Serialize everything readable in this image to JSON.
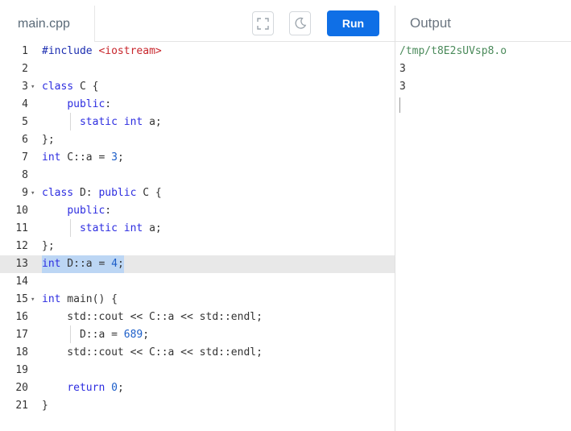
{
  "editor": {
    "file_tab": "main.cpp",
    "fullscreen_icon": "fullscreen-icon",
    "theme_icon": "moon-icon",
    "run_label": "Run",
    "active_line": 13,
    "lines": [
      {
        "n": "1",
        "fold": false,
        "tokens": [
          {
            "t": "#include ",
            "c": "kw"
          },
          {
            "t": "<iostream>",
            "c": "str"
          }
        ]
      },
      {
        "n": "2",
        "fold": false,
        "tokens": []
      },
      {
        "n": "3",
        "fold": true,
        "tokens": [
          {
            "t": "class",
            "c": "kw2"
          },
          {
            "t": " C {",
            "c": "pl"
          }
        ]
      },
      {
        "n": "4",
        "fold": false,
        "tokens": [
          {
            "t": "    ",
            "c": "pl"
          },
          {
            "t": "public",
            "c": "kw2"
          },
          {
            "t": ":",
            "c": "pl"
          }
        ]
      },
      {
        "n": "5",
        "fold": false,
        "tokens": [
          {
            "t": "      ",
            "c": "pl"
          },
          {
            "t": "static",
            "c": "kw2"
          },
          {
            "t": " ",
            "c": "pl"
          },
          {
            "t": "int",
            "c": "kw2"
          },
          {
            "t": " a;",
            "c": "pl"
          }
        ]
      },
      {
        "n": "6",
        "fold": false,
        "tokens": [
          {
            "t": "};",
            "c": "pl"
          }
        ]
      },
      {
        "n": "7",
        "fold": false,
        "tokens": [
          {
            "t": "int",
            "c": "kw2"
          },
          {
            "t": " C::a = ",
            "c": "pl"
          },
          {
            "t": "3",
            "c": "num"
          },
          {
            "t": ";",
            "c": "pl"
          }
        ]
      },
      {
        "n": "8",
        "fold": false,
        "tokens": []
      },
      {
        "n": "9",
        "fold": true,
        "tokens": [
          {
            "t": "class",
            "c": "kw2"
          },
          {
            "t": " D: ",
            "c": "pl"
          },
          {
            "t": "public",
            "c": "kw2"
          },
          {
            "t": " C {",
            "c": "pl"
          }
        ]
      },
      {
        "n": "10",
        "fold": false,
        "tokens": [
          {
            "t": "    ",
            "c": "pl"
          },
          {
            "t": "public",
            "c": "kw2"
          },
          {
            "t": ":",
            "c": "pl"
          }
        ]
      },
      {
        "n": "11",
        "fold": false,
        "tokens": [
          {
            "t": "      ",
            "c": "pl"
          },
          {
            "t": "static",
            "c": "kw2"
          },
          {
            "t": " ",
            "c": "pl"
          },
          {
            "t": "int",
            "c": "kw2"
          },
          {
            "t": " a;",
            "c": "pl"
          }
        ]
      },
      {
        "n": "12",
        "fold": false,
        "tokens": [
          {
            "t": "};",
            "c": "pl"
          }
        ]
      },
      {
        "n": "13",
        "fold": false,
        "selected": true,
        "tokens": [
          {
            "t": "int",
            "c": "kw2"
          },
          {
            "t": " D::a = ",
            "c": "pl"
          },
          {
            "t": "4",
            "c": "num"
          },
          {
            "t": ";",
            "c": "pl"
          }
        ]
      },
      {
        "n": "14",
        "fold": false,
        "tokens": []
      },
      {
        "n": "15",
        "fold": true,
        "tokens": [
          {
            "t": "int",
            "c": "kw2"
          },
          {
            "t": " main() {",
            "c": "pl"
          }
        ]
      },
      {
        "n": "16",
        "fold": false,
        "tokens": [
          {
            "t": "    std::cout << C::a << std::endl;",
            "c": "pl"
          }
        ]
      },
      {
        "n": "17",
        "fold": false,
        "tokens": [
          {
            "t": "      D::a = ",
            "c": "pl"
          },
          {
            "t": "689",
            "c": "num"
          },
          {
            "t": ";",
            "c": "pl"
          }
        ]
      },
      {
        "n": "18",
        "fold": false,
        "tokens": [
          {
            "t": "    std::cout << C::a << std::endl;",
            "c": "pl"
          }
        ]
      },
      {
        "n": "19",
        "fold": false,
        "tokens": []
      },
      {
        "n": "20",
        "fold": false,
        "tokens": [
          {
            "t": "    ",
            "c": "pl"
          },
          {
            "t": "return",
            "c": "kw2"
          },
          {
            "t": " ",
            "c": "pl"
          },
          {
            "t": "0",
            "c": "num"
          },
          {
            "t": ";",
            "c": "pl"
          }
        ]
      },
      {
        "n": "21",
        "fold": false,
        "tokens": [
          {
            "t": "}",
            "c": "pl"
          }
        ]
      }
    ]
  },
  "output": {
    "title": "Output",
    "path": "/tmp/t8E2sUVsp8.o",
    "values": [
      "3",
      "3"
    ]
  },
  "colors": {
    "run_button": "#0f6fe6",
    "selection": "#bcd6f4",
    "active_line": "#e8e8e8",
    "keyword": "#2d2de0",
    "string": "#c8262c",
    "number": "#1c5ec9",
    "output_path": "#4a8a5a"
  }
}
